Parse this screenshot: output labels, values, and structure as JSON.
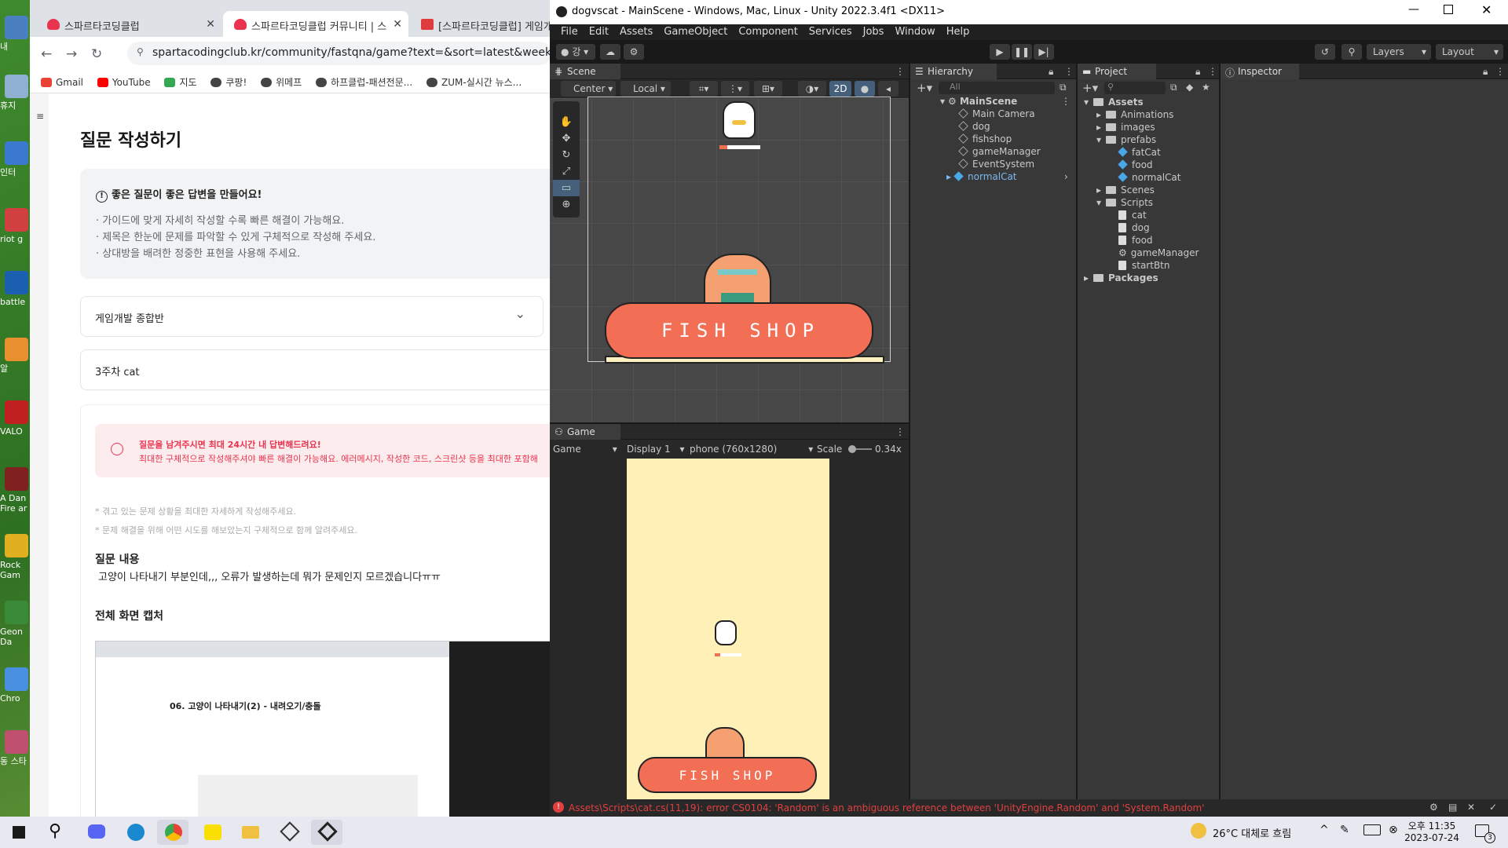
{
  "desktop": {
    "icons": [
      "내",
      "휴지",
      "인터",
      "riot g",
      "battle",
      "알",
      "VALO",
      "A Dan Fire ar",
      "Rock Gam",
      "Geon Da",
      "Chro",
      "동 스타"
    ]
  },
  "chrome": {
    "tabs": [
      {
        "title": "스파르타코딩클럽"
      },
      {
        "title": "스파르타코딩클럽 커뮤니티 | 스"
      },
      {
        "title": "[스파르타코딩클럽] 게임개"
      }
    ],
    "url": "spartacodingclub.kr/community/fastqna/game?text=&sort=latest&week=&pageC",
    "bookmarks": [
      "Gmail",
      "YouTube",
      "지도",
      "쿠팡!",
      "위메프",
      "하프클럽-패션전문...",
      "ZUM-실시간 뉴스..."
    ],
    "page": {
      "heading": "질문 작성하기",
      "guide_title": "좋은 질문이 좋은 답변을 만들어요!",
      "guide_lines": [
        "· 가이드에 맞게 자세히 작성할 수록 빠른 해결이 가능해요.",
        "· 제목은 한눈에 문제를 파악할 수 있게 구체적으로 작성해 주세요.",
        "· 상대방을 배려한 정중한 표현을 사용해 주세요."
      ],
      "course_select": "게임개발 종합반",
      "title_value": "3주차 cat",
      "notice_title": "질문을 남겨주시면 최대 24시간 내 답변해드려요!",
      "notice_body": "최대한 구체적으로 작성해주셔야 빠른 해결이 가능해요. 에러메시지, 작성한 코드, 스크린샷 등을 최대한 포함해",
      "hints": [
        "* 겪고 있는 문제 상황을 최대한 자세하게 작성해주세요.",
        "* 문제 해결을 위해 어떤 시도를 해보았는지 구체적으로 함께 알려주세요."
      ],
      "content_label": "질문 내용",
      "content_text": "고양이 나타내기 부분인데,,, 오류가 발생하는데 뭐가 문제인지 모르겠습니다ㅠㅠ",
      "capture_label": "전체 화면 캡처",
      "thumb_heading": "06. 고양이 나타내기(2) - 내려오기/충돌"
    }
  },
  "unity": {
    "title": "dogvscat - MainScene - Windows, Mac, Linux - Unity 2022.3.4f1 <DX11>",
    "menu": [
      "File",
      "Edit",
      "Assets",
      "GameObject",
      "Component",
      "Services",
      "Jobs",
      "Window",
      "Help"
    ],
    "account": "강",
    "layers": "Layers",
    "layout": "Layout",
    "scene_tab": "Scene",
    "pivot": "Center",
    "space": "Local",
    "mode2d": "2D",
    "shop_text": "FISH  SHOP",
    "game_tab": "Game",
    "game_dropdown": "Game",
    "display": "Display 1",
    "resolution": "phone (760x1280)",
    "scale_label": "Scale",
    "scale_value": "0.34x",
    "hierarchy_tab": "Hierarchy",
    "hierarchy_search": "All",
    "hierarchy_root": "MainScene",
    "hierarchy_items": [
      "Main Camera",
      "dog",
      "fishshop",
      "gameManager",
      "EventSystem",
      "normalCat"
    ],
    "project_tab": "Project",
    "project_tree": [
      {
        "label": "Assets",
        "kind": "folder",
        "level": 0
      },
      {
        "label": "Animations",
        "kind": "folder",
        "level": 1
      },
      {
        "label": "images",
        "kind": "folder",
        "level": 1
      },
      {
        "label": "prefabs",
        "kind": "folder",
        "level": 1
      },
      {
        "label": "fatCat",
        "kind": "prefab",
        "level": 2
      },
      {
        "label": "food",
        "kind": "prefab",
        "level": 2
      },
      {
        "label": "normalCat",
        "kind": "prefab",
        "level": 2
      },
      {
        "label": "Scenes",
        "kind": "folder",
        "level": 1
      },
      {
        "label": "Scripts",
        "kind": "folder",
        "level": 1
      },
      {
        "label": "cat",
        "kind": "script",
        "level": 2
      },
      {
        "label": "dog",
        "kind": "script",
        "level": 2
      },
      {
        "label": "food",
        "kind": "script",
        "level": 2
      },
      {
        "label": "gameManager",
        "kind": "gear",
        "level": 2
      },
      {
        "label": "startBtn",
        "kind": "script",
        "level": 2
      },
      {
        "label": "Packages",
        "kind": "folder",
        "level": 0
      }
    ],
    "inspector_tab": "Inspector",
    "error": "Assets\\Scripts\\cat.cs(11,19): error CS0104: 'Random' is an ambiguous reference between 'UnityEngine.Random' and 'System.Random'"
  },
  "taskbar": {
    "weather": "26°C  대체로 흐림",
    "time": "오후 11:35",
    "date": "2023-07-24",
    "notif_count": "3"
  }
}
